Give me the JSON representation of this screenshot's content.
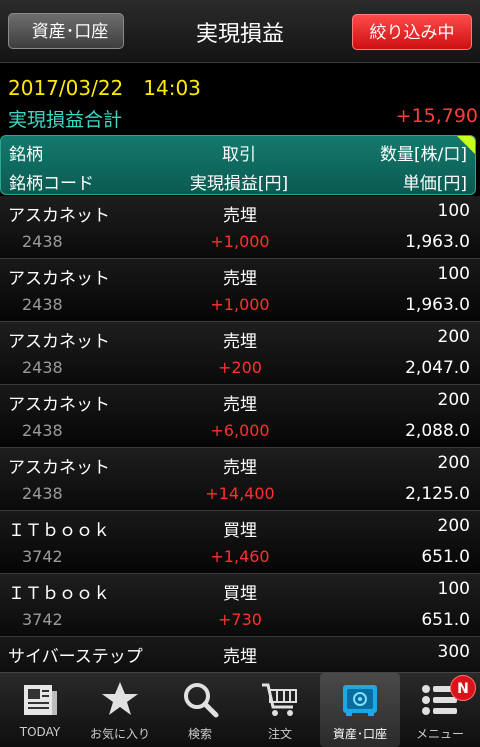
{
  "header": {
    "back_label": "資産･口座",
    "title": "実現損益",
    "filter_label": "絞り込み中"
  },
  "info": {
    "datetime": "2017/03/22　14:03",
    "total_label": "実現損益合計",
    "total_value": "+15,790"
  },
  "columns": {
    "row1": {
      "name": "銘柄",
      "trade": "取引",
      "qty": "数量[株/口]"
    },
    "row2": {
      "code": "銘柄コード",
      "pnl": "実現損益[円]",
      "price": "単価[円]"
    }
  },
  "rows": [
    {
      "name": "アスカネット",
      "code": "2438",
      "trade": "売埋",
      "pnl": "+1,000",
      "qty": "100",
      "price": "1,963.0"
    },
    {
      "name": "アスカネット",
      "code": "2438",
      "trade": "売埋",
      "pnl": "+1,000",
      "qty": "100",
      "price": "1,963.0"
    },
    {
      "name": "アスカネット",
      "code": "2438",
      "trade": "売埋",
      "pnl": "+200",
      "qty": "200",
      "price": "2,047.0"
    },
    {
      "name": "アスカネット",
      "code": "2438",
      "trade": "売埋",
      "pnl": "+6,000",
      "qty": "200",
      "price": "2,088.0"
    },
    {
      "name": "アスカネット",
      "code": "2438",
      "trade": "売埋",
      "pnl": "+14,400",
      "qty": "200",
      "price": "2,125.0"
    },
    {
      "name": "ＩＴｂｏｏｋ",
      "code": "3742",
      "trade": "買埋",
      "pnl": "+1,460",
      "qty": "200",
      "price": "651.0"
    },
    {
      "name": "ＩＴｂｏｏｋ",
      "code": "3742",
      "trade": "買埋",
      "pnl": "+730",
      "qty": "100",
      "price": "651.0"
    },
    {
      "name": "サイバーステップ",
      "code": "",
      "trade": "売埋",
      "pnl": "",
      "qty": "300",
      "price": ""
    }
  ],
  "nav": {
    "items": [
      {
        "label": "TODAY",
        "icon": "newspaper-icon"
      },
      {
        "label": "お気に入り",
        "icon": "star-icon"
      },
      {
        "label": "検索",
        "icon": "search-icon"
      },
      {
        "label": "注文",
        "icon": "cart-icon"
      },
      {
        "label": "資産･口座",
        "icon": "safe-icon"
      },
      {
        "label": "メニュー",
        "icon": "menu-icon"
      }
    ],
    "menu_badge": "N"
  },
  "colors": {
    "accent_teal": "#3ed7c5",
    "profit_red": "#ff3030",
    "datetime_yellow": "#ffeb00",
    "filter_red": "#e02020"
  }
}
